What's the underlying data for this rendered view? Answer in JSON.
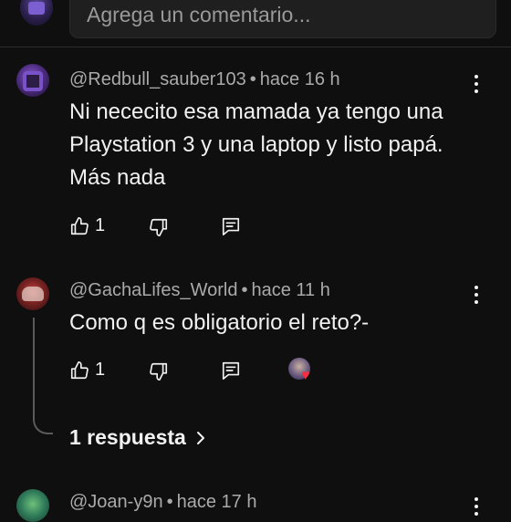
{
  "composer": {
    "placeholder": "Agrega un comentario..."
  },
  "comments": [
    {
      "author": "@Redbull_sauber103",
      "separator": "•",
      "time": "hace 16 h",
      "text": "Ni nececito esa mamada ya tengo una Playstation 3 y una laptop y listo papá. Más nada",
      "likes": "1"
    },
    {
      "author": "@GachaLifes_World",
      "separator": "•",
      "time": "hace 11 h",
      "text": "Como q es obligatorio el reto?-",
      "likes": "1",
      "replies_label": "1 respuesta"
    },
    {
      "author": "@Joan-y9n",
      "separator": "•",
      "time": "hace 17 h"
    }
  ],
  "icons": {
    "like": "thumbs-up-icon",
    "dislike": "thumbs-down-icon",
    "reply": "reply-icon",
    "more": "more-vertical-icon",
    "expand": "chevron-right-icon",
    "creator_heart": "heart-icon"
  },
  "colors": {
    "background": "#0f0f0f",
    "text": "#f1f1f1",
    "secondary_text": "#aaaaaa",
    "heart": "#ff2a3d"
  }
}
